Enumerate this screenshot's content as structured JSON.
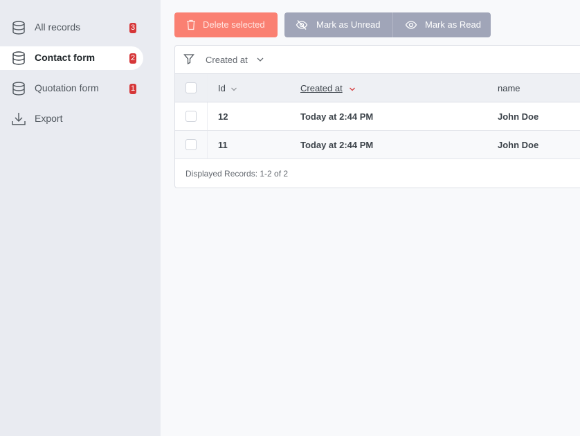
{
  "sidebar": {
    "items": [
      {
        "label": "All records",
        "badge": "3",
        "icon": "database-icon"
      },
      {
        "label": "Contact form",
        "badge": "2",
        "icon": "database-icon",
        "active": true
      },
      {
        "label": "Quotation form",
        "badge": "1",
        "icon": "database-icon"
      },
      {
        "label": "Export",
        "icon": "download-icon"
      }
    ]
  },
  "toolbar": {
    "delete_label": "Delete selected",
    "unread_label": "Mark as Unread",
    "read_label": "Mark as Read"
  },
  "filter": {
    "label": "Created at"
  },
  "table": {
    "columns": [
      "Id",
      "Created at",
      "name"
    ],
    "rows": [
      {
        "id": "12",
        "created_at": "Today at 2:44 PM",
        "name": "John Doe"
      },
      {
        "id": "11",
        "created_at": "Today at 2:44 PM",
        "name": "John Doe"
      }
    ],
    "footer": "Displayed Records: 1-2 of 2"
  },
  "colors": {
    "sidebar_bg": "#e9ebf1",
    "delete_button": "#fa8072",
    "mark_buttons": "#a0a5b8",
    "badge": "#d63638",
    "sort_active": "#d63638"
  }
}
